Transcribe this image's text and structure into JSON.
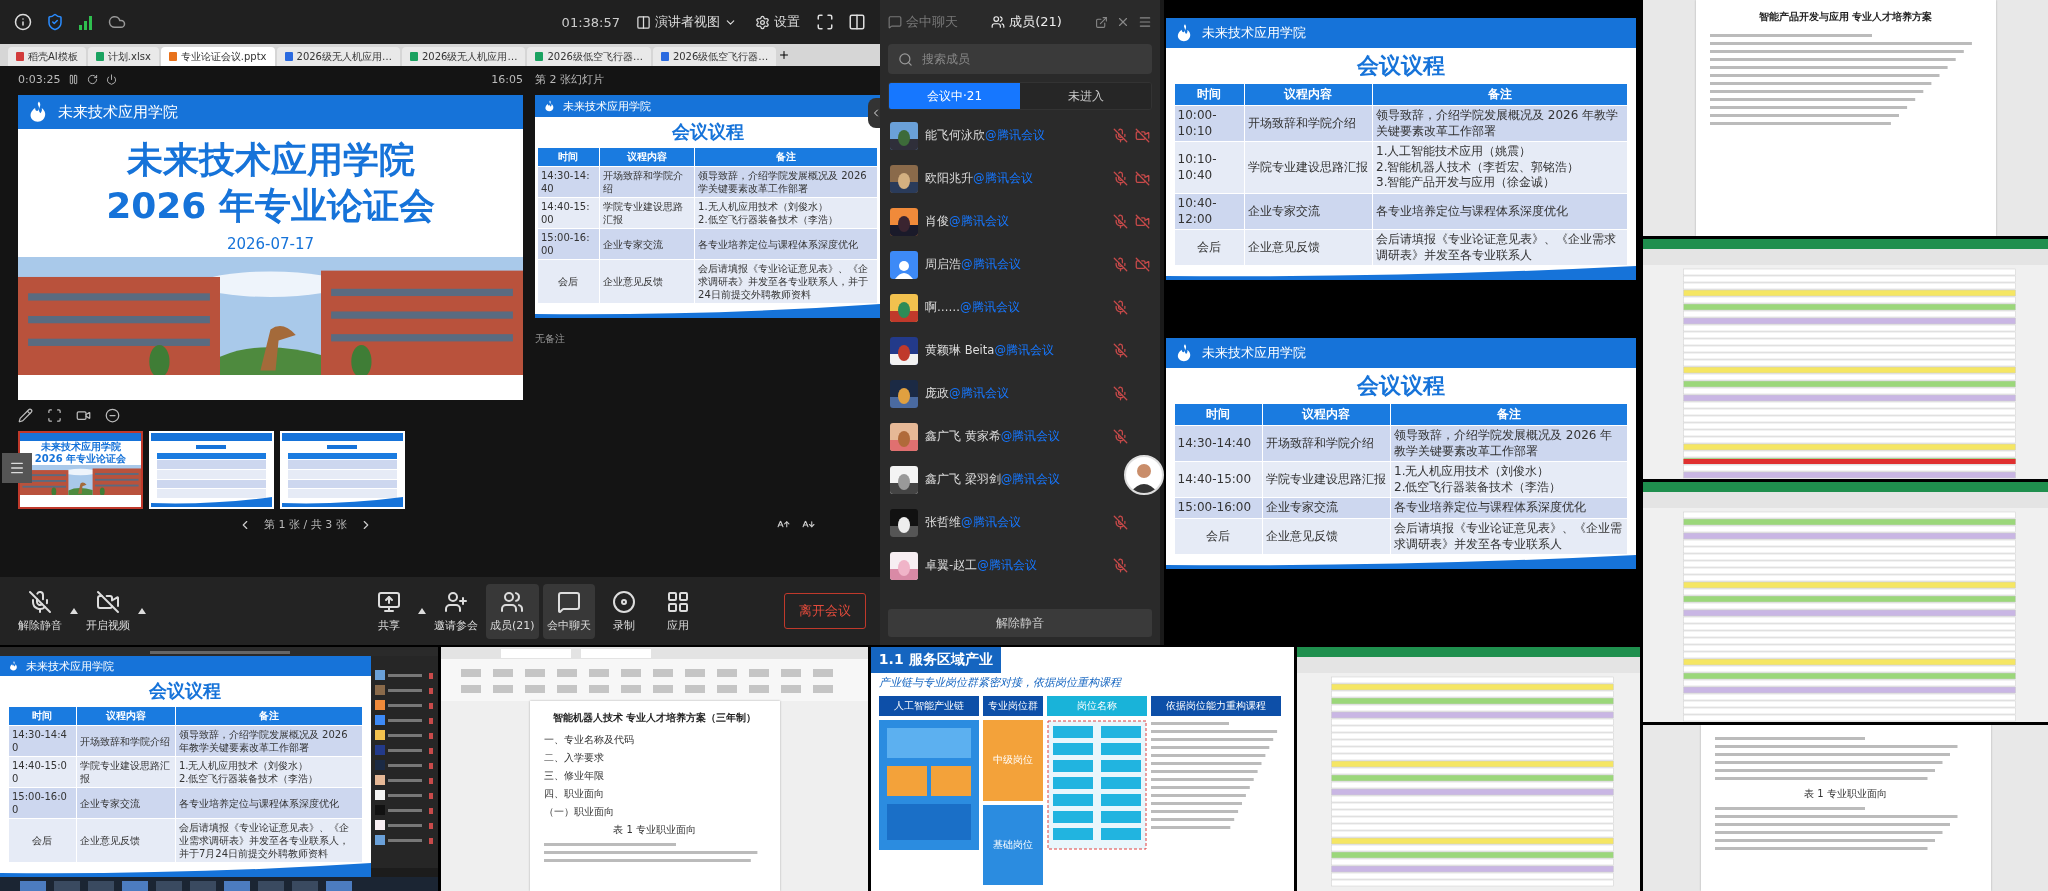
{
  "meeting": {
    "clock": "01:38:57",
    "view_menu": "演讲者视图",
    "settings": "设置",
    "browser_tabs": [
      {
        "label": "稻壳AI模板",
        "selected": false
      },
      {
        "label": "计划.xlsx",
        "selected": false
      },
      {
        "label": "专业论证会议.pptx",
        "selected": true
      },
      {
        "label": "2026级无人机应用…",
        "selected": false
      },
      {
        "label": "2026级无人机应用…",
        "selected": false
      },
      {
        "label": "2026级低空飞行器…",
        "selected": false
      },
      {
        "label": "2026级低空飞行器…",
        "selected": false
      }
    ],
    "presenter": {
      "elapsed": "0:03:25",
      "clock": "16:05",
      "next_label": "第 2 张幻灯片",
      "notes": "无备注",
      "pager": "第 1 张 / 共 3 张"
    },
    "title_slide": {
      "school": "未来技术应用学院",
      "title": "未来技术应用学院",
      "subtitle": "2026 年专业论证会",
      "date": "2026-07-17"
    },
    "next_slide": {
      "school": "未来技术应用学院",
      "title": "会议议程",
      "headers": [
        "时间",
        "议程内容",
        "备注"
      ],
      "rows": [
        {
          "time": "14:30-14:40",
          "item": "开场致辞和学院介绍",
          "note_lines": [
            "领导致辞，介绍学院发展概况及 2026",
            "学关键要素改革工作部署"
          ]
        },
        {
          "time": "14:40-15:00",
          "item": "学院专业建设思路汇报",
          "note_lines": [
            "1.无人机应用技术（刘俊水）",
            "2.低空飞行器装备技术（李浩）"
          ]
        },
        {
          "time": "15:00-16:00",
          "item": "企业专家交流",
          "note_lines": [
            "各专业培养定位与课程体系深度优化"
          ]
        },
        {
          "time": "会后",
          "item": "企业意见反馈",
          "note_lines": [
            "会后请填报《专业论证意见表》、《企",
            "求调研表》并发至各专业联系人，并于",
            "24日前提交外聘教师资料"
          ]
        }
      ]
    },
    "thumbnails": [
      {
        "kind": "title",
        "selected": true,
        "lines": [
          "未来技术应用学院",
          "2026 年专业论证会"
        ]
      },
      {
        "kind": "agenda",
        "selected": false
      },
      {
        "kind": "agenda",
        "selected": false
      }
    ],
    "toolbar": [
      {
        "kind": "mic",
        "label": "解除静音",
        "menu": true,
        "selected": false
      },
      {
        "kind": "video",
        "label": "开启视频",
        "menu": true,
        "selected": false
      },
      {
        "kind": "share",
        "label": "共享",
        "menu": true,
        "selected": false
      },
      {
        "kind": "invite",
        "label": "邀请参会",
        "menu": false,
        "selected": false
      },
      {
        "kind": "members",
        "label": "成员(21)",
        "menu": false,
        "selected": true
      },
      {
        "kind": "chat",
        "label": "会中聊天",
        "menu": false,
        "selected": true
      },
      {
        "kind": "record",
        "label": "录制",
        "menu": false,
        "selected": false
      },
      {
        "kind": "apps",
        "label": "应用",
        "menu": false,
        "selected": false
      }
    ],
    "leave": "离开会议"
  },
  "members_panel": {
    "chat_tab": "会中聊天",
    "members_tab": "成员(21)",
    "search_placeholder": "搜索成员",
    "tabs": [
      {
        "label": "会议中·21",
        "selected": true
      },
      {
        "label": "未进入",
        "selected": false
      }
    ],
    "members": [
      {
        "kind": "picture",
        "name": "能飞何泳欣",
        "suffix": "@腾讯会议",
        "muted": true,
        "video_off": true
      },
      {
        "kind": "picture",
        "name": "欧阳兆升",
        "suffix": "@腾讯会议",
        "muted": true,
        "video_off": true
      },
      {
        "kind": "picture",
        "name": "肖俊",
        "suffix": "@腾讯会议",
        "muted": true,
        "video_off": true
      },
      {
        "kind": "default",
        "name": "周启浩",
        "suffix": "@腾讯会议",
        "muted": true,
        "video_off": true
      },
      {
        "kind": "picture",
        "name": "啊……",
        "suffix": "@腾讯会议",
        "muted": true,
        "video_off": false
      },
      {
        "kind": "picture",
        "name": "黄颖琳 Beita",
        "suffix": "@腾讯会议",
        "muted": true,
        "video_off": false
      },
      {
        "kind": "picture",
        "name": "庞政",
        "suffix": "@腾讯会议",
        "muted": true,
        "video_off": false
      },
      {
        "kind": "picture",
        "name": "鑫广飞 黄家希",
        "suffix": "@腾讯会议",
        "muted": true,
        "video_off": false
      },
      {
        "kind": "picture",
        "name": "鑫广飞 梁羽剑",
        "suffix": "@腾讯会议",
        "muted": false,
        "video_off": false
      },
      {
        "kind": "picture",
        "name": "张哲维",
        "suffix": "@腾讯会议",
        "muted": true,
        "video_off": false
      },
      {
        "kind": "picture",
        "name": "卓翼-赵工",
        "suffix": "@腾讯会议",
        "muted": true,
        "video_off": false
      }
    ],
    "unmute_all": "解除静音"
  },
  "agenda_slides": [
    {
      "school": "未来技术应用学院",
      "title": "会议议程",
      "headers": [
        "时间",
        "议程内容",
        "备注"
      ],
      "rows": [
        {
          "time": "10:00-\n10:10",
          "item": "开场致辞和学院介绍",
          "note": "领导致辞，介绍学院发展概况及 2026 年教学关键要素改革工作部署"
        },
        {
          "time": "10:10-\n10:40",
          "item": "学院专业建设思路汇报",
          "note": "1.人工智能技术应用（姚震）\n2.智能机器人技术（李哲宏、郭铭浩）\n3.智能产品开发与应用（徐金诚）"
        },
        {
          "time": "10:40-\n12:00",
          "item": "企业专家交流",
          "note": "各专业培养定位与课程体系深度优化"
        },
        {
          "time": "会后",
          "item": "企业意见反馈",
          "note": "会后请填报《专业论证意见表》、《企业需求调研表》并发至各专业联系人"
        }
      ]
    },
    {
      "school": "未来技术应用学院",
      "title": "会议议程",
      "headers": [
        "时间",
        "议程内容",
        "备注"
      ],
      "rows": [
        {
          "time": "14:30-14:40",
          "item": "开场致辞和学院介绍",
          "note": "领导致辞，介绍学院发展概况及 2026 年教学关键要素改革工作部署"
        },
        {
          "time": "14:40-15:00",
          "item": "学院专业建设思路汇报",
          "note": "1.无人机应用技术（刘俊水）\n2.低空飞行器装备技术（李浩）"
        },
        {
          "time": "15:00-16:00",
          "item": "企业专家交流",
          "note": "各专业培养定位与课程体系深度优化"
        },
        {
          "time": "会后",
          "item": "企业意见反馈",
          "note": "会后请填报《专业论证意见表》、《企业需求调研表》并发至各专业联系人"
        }
      ]
    }
  ],
  "mini_meeting": {
    "slide": {
      "school": "未来技术应用学院",
      "title": "会议议程",
      "headers": [
        "时间",
        "议程内容",
        "备注"
      ],
      "rows": [
        {
          "time": "14:30-14:40",
          "item": "开场致辞和学院介绍",
          "note": "领导致辞，介绍学院发展概况及 2026 年教学关键要素改革工作部署"
        },
        {
          "time": "14:40-15:00",
          "item": "学院专业建设思路汇报",
          "note": "1.无人机应用技术（刘俊水）\n2.低空飞行器装备技术（李浩）"
        },
        {
          "time": "15:00-16:00",
          "item": "企业专家交流",
          "note": "各专业培养定位与课程体系深度优化"
        },
        {
          "time": "会后",
          "item": "企业意见反馈",
          "note": "会后请填报《专业论证意见表》、《企业需求调研表》并发至各专业联系人，并于7月24日前提交外聘教师资料"
        }
      ]
    }
  },
  "document": {
    "title": "智能机器人技术 专业人才培养方案（三年制）",
    "lines": [
      "一、专业名称及代码",
      "二、入学要求",
      "三、修业年限",
      "四、职业面向",
      "（一）职业面向"
    ],
    "table_caption": "表 1 专业职业面向"
  },
  "industry_slide": {
    "heading": "1.1 服务区域产业",
    "subtitle": "产业链与专业岗位群紧密对接，依据岗位重构课程",
    "chain": "人工智能产业链",
    "group": "专业岗位群",
    "levels": [
      "中级岗位",
      "基础岗位"
    ],
    "positions": "岗位名称",
    "courses": "依据岗位能力重构课程"
  },
  "side_document": {
    "title": "智能产品开发与应用 专业人才培养方案"
  },
  "side_document_2": {
    "table_caption": "表 1 专业职业面向"
  }
}
